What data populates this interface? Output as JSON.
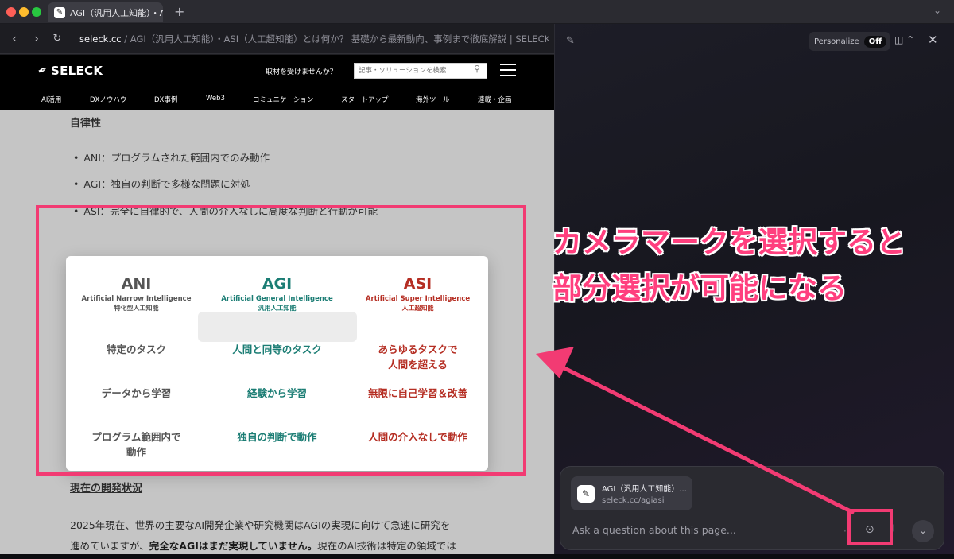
{
  "tabbar": {
    "tab_title": "AGI（汎用人工知能）・ASI",
    "new_tab_glyph": "+",
    "dropdown_glyph": "⌄"
  },
  "addressbar": {
    "back_glyph": "‹",
    "forward_glyph": "›",
    "reload_glyph": "↻",
    "domain": "seleck.cc",
    "path": " / AGI（汎用人工知能）・ASI（人工超知能）とは何か？ 基礎から最新動向、事例まで徹底解説 | SELECK [セレック]"
  },
  "site_header": {
    "logo_text": "SELECK",
    "cta": "取材を受けませんか？",
    "search_placeholder": "記事・ソリューションを検索"
  },
  "categories": [
    "AI活用",
    "DXノウハウ",
    "DX事例",
    "Web3",
    "コミュニケーション",
    "スタートアップ",
    "海外ツール",
    "連載・企画"
  ],
  "article": {
    "heading_autonomy": "自律性",
    "bullets": [
      "ANI：プログラムされた範囲内でのみ動作",
      "AGI：独自の判断で多様な問題に対処",
      "ASI：完全に自律的で、人間の介入なしに高度な判断と行動が可能"
    ],
    "heading_status": "現在の開発状況",
    "body_line1": "2025年現在、世界の主要なAI開発企業や研究機関はAGIの実現に向けて急速に研究を",
    "body_line2_a": "進めていますが、",
    "body_line2_b": "完全なAGIはまだ実現していません。",
    "body_line2_c": "現在のAI技術は特定の領域では"
  },
  "comparison": {
    "columns": [
      {
        "abbr": "ANI",
        "en": "Artificial Narrow Intelligence",
        "jp": "特化型人工知能",
        "color": "#555555"
      },
      {
        "abbr": "AGI",
        "en": "Artificial General Intelligence",
        "jp": "汎用人工知能",
        "color": "#1b7d74"
      },
      {
        "abbr": "ASI",
        "en": "Artificial Super Intelligence",
        "jp": "人工超知能",
        "color": "#b52e23"
      }
    ],
    "rows": [
      [
        "特定のタスク",
        "人間と同等のタスク",
        "あらゆるタスクで\n人間を超える"
      ],
      [
        "データから学習",
        "経験から学習",
        "無限に自己学習＆改善"
      ],
      [
        "プログラム範囲内で\n動作",
        "独自の判断で動作",
        "人間の介入なしで動作"
      ]
    ]
  },
  "panel": {
    "personalize_label": "Personalize",
    "personalize_state": "Off",
    "annotation_line1": "カメラマークを選択すると",
    "annotation_line2": "部分選択が可能になる",
    "chip_title": "AGI（汎用人工知能）...",
    "chip_url": "seleck.cc/agiasi",
    "ask_placeholder": "Ask a question about this page..."
  },
  "colors": {
    "highlight": "#f23b73",
    "annotation_text": "#ff3f7e"
  },
  "icons": {
    "compose": "compose-icon",
    "layout": "sidebar-layout-icon",
    "close": "close-icon",
    "camera": "camera-icon",
    "mic": "microphone-icon",
    "search": "search-icon"
  }
}
